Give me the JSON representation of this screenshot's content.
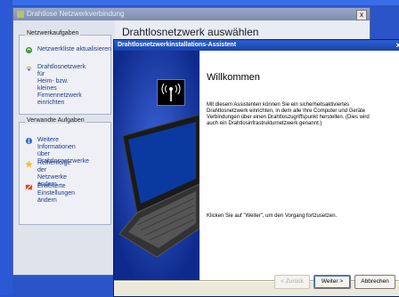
{
  "back_window": {
    "title": "Drahtlose Netzwerkverbindung",
    "close": "x",
    "main_title": "Drahtlosnetzwerk auswählen",
    "groups": [
      {
        "header": "Netzwerkaufgaben",
        "items": [
          {
            "label": "Netzwerkliste aktualisieren",
            "icon": "refresh-icon"
          },
          {
            "label": "Drahtlosnetzwerk für\nHeim- bzw. kleines\nFirmennetzwerk einrichten",
            "icon": "wireless-setup-icon"
          }
        ]
      },
      {
        "header": "Verwandte Aufgaben",
        "items": [
          {
            "label": "Weitere Informationen\nüber Drahtlosnetzwerke",
            "icon": "info-icon"
          },
          {
            "label": "Reihenfolge der\nNetzwerke ändern",
            "icon": "star-icon"
          },
          {
            "label": "Erweiterte Einstellungen\nändern",
            "icon": "settings-icon"
          }
        ]
      }
    ]
  },
  "wizard": {
    "title": "Drahtlosnetzwerkinstallations-Assistent",
    "close": "x",
    "welcome_title": "Willkommen",
    "intro": "Mit diesem Assistenten können Sie ein sicherheitsaktiviertes Drahtlosnetzwerk einrichten, in dem alle Ihre Computer und Geräte Verbindungen über einen Drahtloszugriffspunkt herstellen. (Dies wird auch ein Drahtlosinfrastrukturnetzwerk genannt.)",
    "instruction": "Klicken Sie auf \"Weiter\", um den Vorgang fortzusetzen.",
    "buttons": {
      "back": "< Zurück",
      "next": "Weiter >",
      "cancel": "Abbrechen"
    }
  },
  "colors": {
    "desktop": "#2a54c8",
    "wizard_banner": "#1434a0",
    "titlebar": "#2b5fd0"
  }
}
